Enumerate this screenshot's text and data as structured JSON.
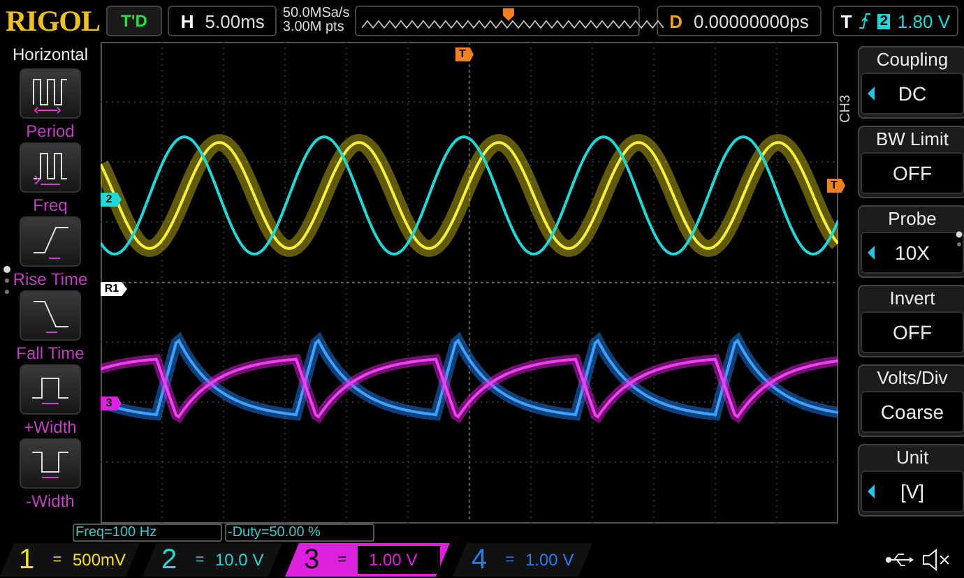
{
  "top_bar": {
    "logo": "RIGOL",
    "run_state": "T'D",
    "horizontal": {
      "label": "H",
      "value": "5.00ms"
    },
    "sample_rate": "50.0MSa/s",
    "memory_depth": "3.00M pts",
    "delay": {
      "label": "D",
      "value": "0.00000000ps"
    },
    "trigger": {
      "label": "T",
      "source": "2",
      "level": "1.80 V"
    }
  },
  "left_menu": {
    "title": "Horizontal",
    "items": [
      {
        "kind": "period",
        "label": "Period"
      },
      {
        "kind": "freq",
        "label": "Freq"
      },
      {
        "kind": "rise",
        "label": "Rise Time"
      },
      {
        "kind": "fall",
        "label": "Fall Time"
      },
      {
        "kind": "pwidth",
        "label": "+Width"
      },
      {
        "kind": "nwidth",
        "label": "-Width"
      }
    ]
  },
  "screen": {
    "markers": [
      {
        "kind": "trigger_position",
        "label": "T",
        "color": "#f08020"
      },
      {
        "kind": "channel",
        "label": "2",
        "color": "#20d8d8"
      },
      {
        "kind": "reference",
        "label": "R1",
        "color": "#ffffff"
      },
      {
        "kind": "channel",
        "label": "3",
        "color": "#e020e0"
      },
      {
        "kind": "trigger_level",
        "label": "T",
        "color": "#f08020"
      }
    ]
  },
  "right_menu": {
    "channel": "CH3",
    "items": [
      {
        "label": "Coupling",
        "value": "DC",
        "adjustable": true
      },
      {
        "label": "BW Limit",
        "value": "OFF",
        "adjustable": false
      },
      {
        "label": "Probe",
        "value": "10X",
        "adjustable": true
      },
      {
        "label": "Invert",
        "value": "OFF",
        "adjustable": false
      },
      {
        "label": "Volts/Div",
        "value": "Coarse",
        "adjustable": false
      },
      {
        "label": "Unit",
        "value": "[V]",
        "adjustable": true
      }
    ]
  },
  "measurements": [
    "Freq=100 Hz",
    "-Duty=50.00 %"
  ],
  "channels": [
    {
      "number": "1",
      "coupling": "=",
      "scale": "500mV",
      "color": "#f0e020",
      "selected": false
    },
    {
      "number": "2",
      "coupling": "=",
      "scale": "10.0 V",
      "color": "#20d8d8",
      "selected": false
    },
    {
      "number": "3",
      "coupling": "=",
      "scale": "1.00 V",
      "color": "#e020e0",
      "selected": true
    },
    {
      "number": "4",
      "coupling": "=",
      "scale": "1.00 V",
      "color": "#2080f0",
      "selected": false
    }
  ]
}
